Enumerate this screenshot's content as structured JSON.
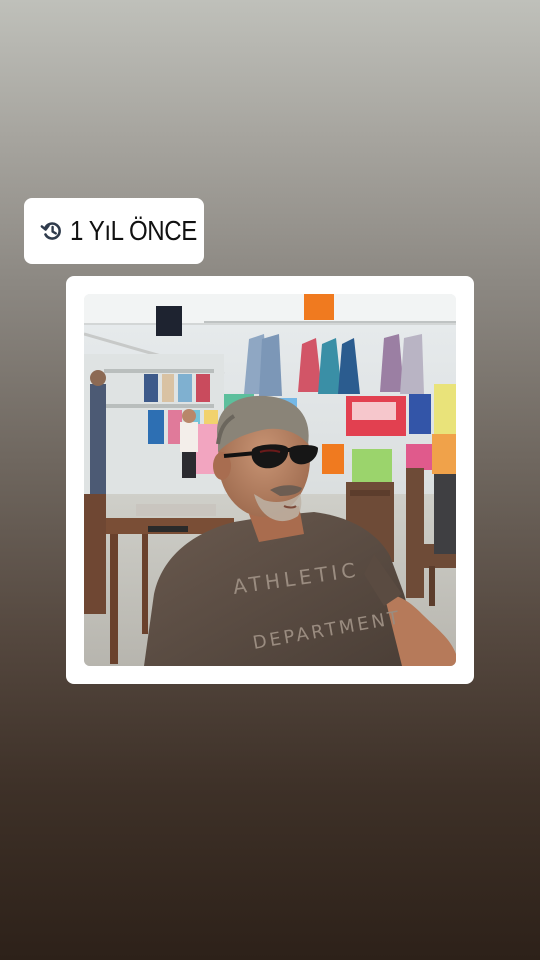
{
  "memory_sticker": {
    "icon": "history-icon",
    "label": "1 YıL ÖNCE"
  },
  "photo": {
    "description_icon": "photo-memory"
  },
  "colors": {
    "sticker_bg": "#ffffff",
    "sticker_text": "#111111",
    "icon_color": "#2f3b4c",
    "gradient_top": "#bfc0ba",
    "gradient_bottom": "#2d2119"
  }
}
